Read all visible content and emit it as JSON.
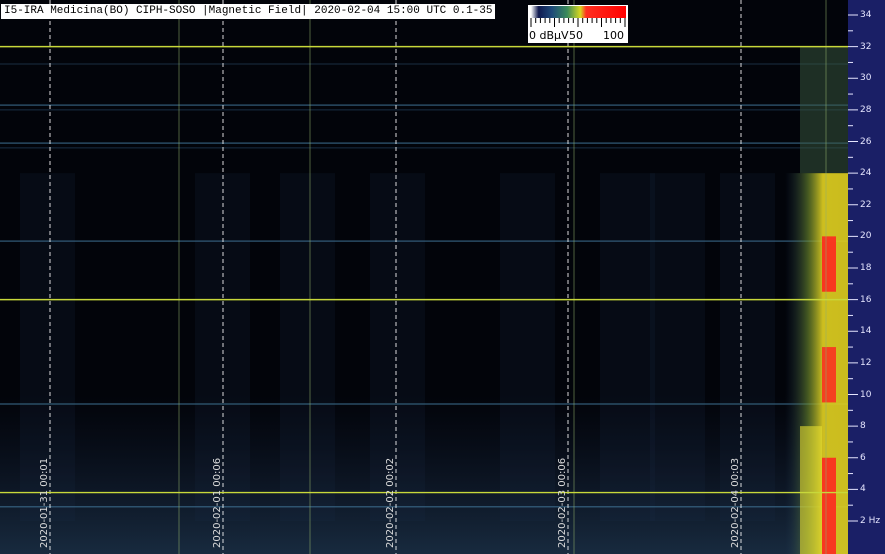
{
  "title": "I5-IRA Medicina(BO) CIPH-SOSO |Magnetic Field| 2020-02-04 15:00 UTC 0.1-35",
  "legend": {
    "min_label": "0 dBµV",
    "mid_label": "50",
    "max_label": "100",
    "colors": [
      "#ffffff",
      "#1a2a6a",
      "#2f7a6a",
      "#c8d020",
      "#ff2020",
      "#ff0000"
    ]
  },
  "colors": {
    "background": "#000000",
    "axis_panel": "#1a1f66",
    "marker_line": "#c8d83a",
    "time_grid": "#ffffff"
  },
  "chart_data": {
    "type": "heatmap",
    "title": "I5-IRA Medicina(BO) CIPH-SOSO |Magnetic Field| 2020-02-04 15:00 UTC 0.1-35",
    "x_tick_labels": [
      "2020-01-31 00:01",
      "2020-02-01 00:06",
      "2020-02-02 00:02",
      "2020-02-03 00:06",
      "2020-02-04 00:03"
    ],
    "y_unit": "Hz",
    "y_ticks": [
      2,
      4,
      6,
      8,
      10,
      12,
      14,
      16,
      18,
      20,
      22,
      24,
      26,
      28,
      30,
      32,
      34
    ],
    "y_tick_labels": [
      "2 Hz",
      "4",
      "6",
      "8",
      "10",
      "12",
      "14",
      "16",
      "18",
      "20",
      "22",
      "24",
      "26",
      "28",
      "30",
      "32",
      "34"
    ],
    "ylim": [
      0,
      35
    ],
    "marker_lines_hz": [
      3.8,
      16.0,
      32.0
    ],
    "persistent_lines_hz": [
      9.4,
      2.9,
      19.7,
      25.9,
      28.3
    ],
    "colorbar_range_dbuv": [
      0,
      100
    ],
    "event": {
      "start_day": "2020-02-04",
      "description_level": "strong broadband emission up to ~32 Hz"
    }
  }
}
